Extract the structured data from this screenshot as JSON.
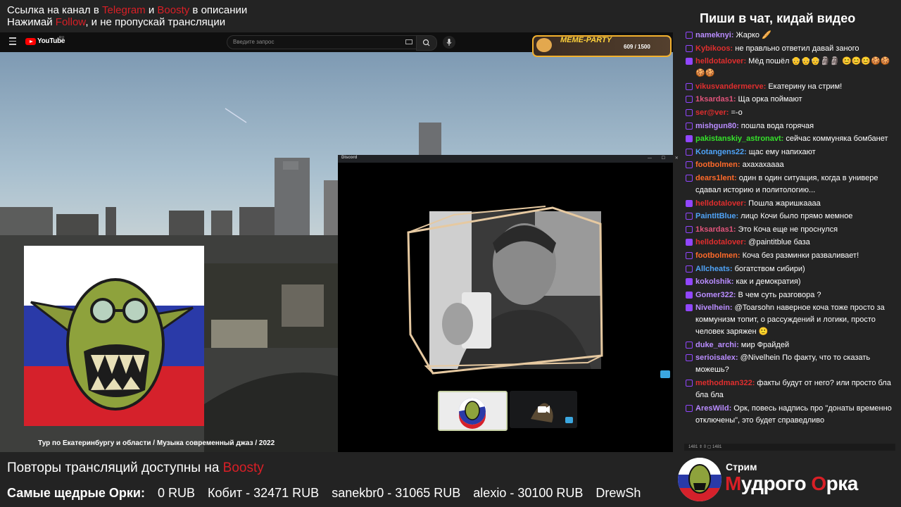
{
  "overlay": {
    "line1": {
      "a": "Ссылка на канал в ",
      "b": "Telegram",
      "c": " и ",
      "d": "Boosty",
      "e": " в описании"
    },
    "line2": {
      "a": "Нажимай ",
      "b": "Follow",
      "c": ", и не пропускай трансляции"
    }
  },
  "youtube": {
    "logo": "YouTube",
    "region": "RU",
    "search_placeholder": "Введите запрос",
    "video_title": "Тур по Екатеринбургу и области / Музыка современный джаз / 2022"
  },
  "meme_party": {
    "title": "MEME-PARTY",
    "count": "609 / 1500"
  },
  "discord": {
    "title": "Discord",
    "controls": "— ☐ ✕"
  },
  "chat": {
    "title": "Пиши в чат, кидай видео",
    "messages": [
      {
        "user": "nameknyi:",
        "text": "Жарко 🥖",
        "color": "#b98cff",
        "badge": false
      },
      {
        "user": "Kybikoos:",
        "text": "не правльно ответил давай заного",
        "color": "#e02e2e",
        "badge": false
      },
      {
        "user": "helldotalover:",
        "text": "Мёд пошёл 👴👴👴🗿🗿 😊😊😊🍪🍪🍪🍪",
        "color": "#e02e2e",
        "badge": true
      },
      {
        "user": "vikusvandermerve:",
        "text": "Екатерину на стрим!",
        "color": "#e02e2e",
        "badge": false
      },
      {
        "user": "1ksardas1:",
        "text": "Ща орка поймают",
        "color": "#e0537a",
        "badge": false
      },
      {
        "user": "ser@ver:",
        "text": "=-o",
        "color": "#e02e2e",
        "badge": false
      },
      {
        "user": "mishgun80:",
        "text": "пошла вода горячая",
        "color": "#b98cff",
        "badge": false
      },
      {
        "user": "pakistanskiy_astronavt:",
        "text": "сейчас коммуняка бомбанет",
        "color": "#35e22b",
        "badge": true
      },
      {
        "user": "Kotangens22:",
        "text": "щас ему напихают",
        "color": "#4fa3f7",
        "badge": false
      },
      {
        "user": "footbolmen:",
        "text": "ахахахаааа",
        "color": "#ff6a2a",
        "badge": false
      },
      {
        "user": "dears1lent:",
        "text": "один в один ситуация, когда в универе сдавал историю и политологию...",
        "color": "#ff6a2a",
        "badge": false
      },
      {
        "user": "helldotalover:",
        "text": "Пошла жаришкаааа",
        "color": "#e02e2e",
        "badge": true
      },
      {
        "user": "PaintItBlue:",
        "text": "лицо Кочи было прямо мемное",
        "color": "#4fa3f7",
        "badge": false
      },
      {
        "user": "1ksardas1:",
        "text": "Это Коча еще не проснулся",
        "color": "#e0537a",
        "badge": false
      },
      {
        "user": "helldotalover:",
        "text": "@paintitblue база",
        "color": "#e02e2e",
        "badge": true
      },
      {
        "user": "footbolmen:",
        "text": "Коча без разминки разваливает!",
        "color": "#ff6a2a",
        "badge": false
      },
      {
        "user": "Allcheats:",
        "text": "богатством сибири)",
        "color": "#4fa3f7",
        "badge": false
      },
      {
        "user": "kokolshik:",
        "text": "как и демократия)",
        "color": "#b98cff",
        "badge": true
      },
      {
        "user": "Gomer322:",
        "text": "В чем суть разговора ?",
        "color": "#b98cff",
        "badge": true
      },
      {
        "user": "Nivelhein:",
        "text": "@Toarsohn наверное коча тоже просто за коммунизм топит, о рассуждений и логики, просто человек заряжен 🙂",
        "color": "#b98cff",
        "badge": true
      },
      {
        "user": "duke_archi:",
        "text": "мир Фрайдей",
        "color": "#b98cff",
        "badge": false
      },
      {
        "user": "serioisalex:",
        "text": "@Nivelhein По факту, что то сказать можешь?",
        "color": "#b98cff",
        "badge": false
      },
      {
        "user": "methodman322:",
        "text": "факты будут от него? или просто бла бла бла",
        "color": "#e02e2e",
        "badge": false
      },
      {
        "user": "AresWild:",
        "text": "Орк, повесь надпись про \"донаты временно отключены\", это будет справедливо",
        "color": "#b98cff",
        "badge": false
      }
    ],
    "footer": "1481 ⇕ 0 ▢ 1481"
  },
  "bottom": {
    "replays_a": "Повторы трансляций доступны на ",
    "replays_b": "Boosty",
    "donors_label": "Самые щедрые Орки:",
    "donors": [
      "0 RUB",
      "Кобит - 32471 RUB",
      "sanekbr0 - 31065 RUB",
      "alexio - 30100 RUB",
      "DrewSh"
    ]
  },
  "branding": {
    "small": "Стрим",
    "big_a": "М",
    "big_b": "удрого ",
    "big_c": "О",
    "big_d": "рка"
  },
  "colors": {
    "accent_red": "#d91f26",
    "twitch_purple": "#9146ff",
    "bg": "#232323"
  }
}
